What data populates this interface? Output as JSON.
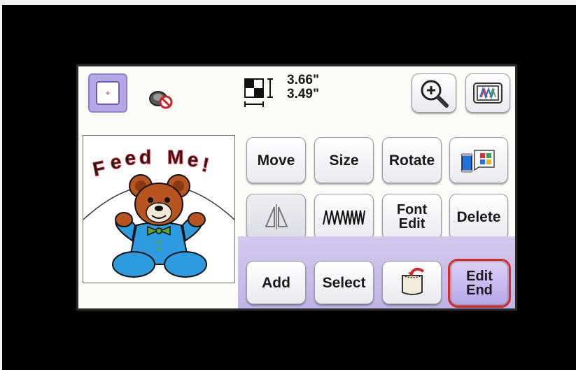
{
  "dimensions": {
    "width": "3.66\"",
    "height": "3.49\""
  },
  "buttons": {
    "move": "Move",
    "size": "Size",
    "rotate": "Rotate",
    "font_edit": "Font\nEdit",
    "delete": "Delete",
    "add": "Add",
    "select": "Select",
    "edit_end_line1": "Edit",
    "edit_end_line2": "End",
    "font_line1": "Font",
    "font_line2": "Edit"
  },
  "design": {
    "text": "Feed Me!"
  },
  "icons": {
    "frame": "embroidery-frame-icon",
    "no_thread": "no-bobbin-icon",
    "size_indicator": "design-size-icon",
    "zoom": "magnifier-zoom-icon",
    "preview": "embroidery-preview-icon",
    "thread_color": "thread-color-palette-icon",
    "mirror": "mirror-flip-icon",
    "density": "stitch-density-icon",
    "memory": "memory-pocket-icon"
  },
  "colors": {
    "accent_purple": "#b6a8e6",
    "highlight_red": "#d42a2a",
    "bear_brown": "#b8541f",
    "bear_blue": "#2c9be0",
    "bow_green": "#5aa832"
  }
}
